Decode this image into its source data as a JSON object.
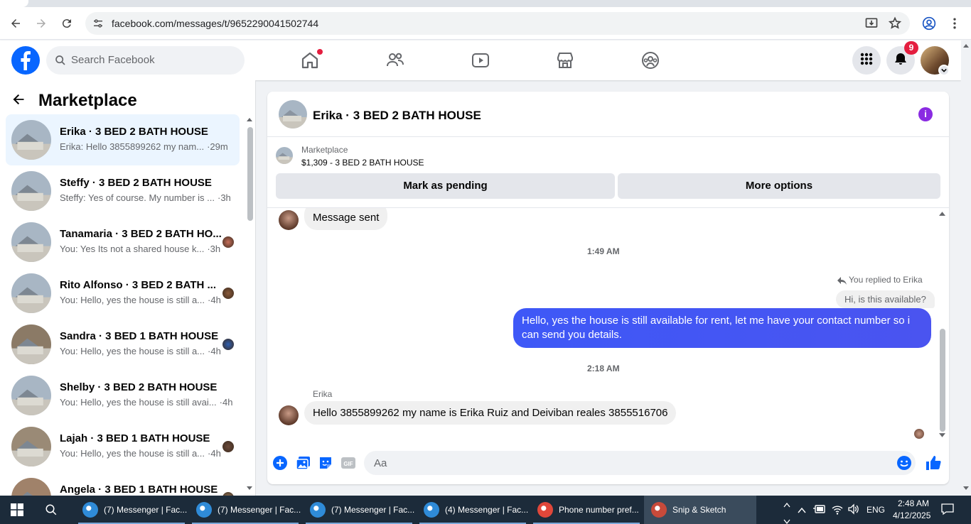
{
  "browser": {
    "url": "facebook.com/messages/t/9652290041502744"
  },
  "fb_header": {
    "search_placeholder": "Search Facebook",
    "notification_count": "9"
  },
  "sidebar": {
    "title": "Marketplace",
    "conversations": [
      {
        "title": "Erika · 3 BED 2 BATH HOUSE",
        "preview": "Erika: Hello 3855899262 my nam...",
        "time": "·29m",
        "active": true
      },
      {
        "title": "Steffy · 3 BED 2 BATH HOUSE",
        "preview": "Steffy: Yes of course. My number is ...",
        "time": "·3h",
        "active": false
      },
      {
        "title": "Tanamaria · 3 BED 2 BATH HO...",
        "preview": "You: Yes Its not a shared house k...",
        "time": "·3h",
        "active": false
      },
      {
        "title": "Rito Alfonso · 3 BED 2 BATH ...",
        "preview": "You: Hello, yes the house is still a...",
        "time": "·4h",
        "active": false
      },
      {
        "title": "Sandra · 3 BED 1 BATH HOUSE",
        "preview": "You: Hello, yes the house is still a...",
        "time": "·4h",
        "active": false
      },
      {
        "title": "Shelby · 3 BED 2 BATH HOUSE",
        "preview": "You: Hello, yes the house is still avai...",
        "time": "·4h",
        "active": false
      },
      {
        "title": "Lajah · 3 BED 1 BATH HOUSE",
        "preview": "You: Hello, yes the house is still a...",
        "time": "·4h",
        "active": false
      },
      {
        "title": "Angela · 3 BED 1 BATH HOUSE",
        "preview": "",
        "time": "",
        "active": false
      }
    ]
  },
  "chat": {
    "title": "Erika · 3 BED 2 BATH HOUSE",
    "listing": {
      "label": "Marketplace",
      "price_title": "$1,309 - 3 BED 2 BATH HOUSE",
      "mark_pending": "Mark as pending",
      "more_options": "More options"
    },
    "messages": {
      "msg_sent": "Message sent",
      "time_1": "1:49 AM",
      "replied_to": "You replied to Erika",
      "quoted": "Hi, is this available?",
      "reply": "Hello, yes the house is still available for rent, let me have your contact number so i can send you details.",
      "time_2": "2:18 AM",
      "sender_name": "Erika",
      "incoming": "Hello  3855899262 my name is Erika Ruiz and Deiviban reales 3855516706"
    },
    "composer_placeholder": "Aa"
  },
  "taskbar": {
    "items": [
      {
        "label": "(7) Messenger | Fac...",
        "active": false
      },
      {
        "label": "(7) Messenger | Fac...",
        "active": false
      },
      {
        "label": "(7) Messenger | Fac...",
        "active": false
      },
      {
        "label": "(4) Messenger | Fac...",
        "active": false
      },
      {
        "label": "Phone number pref...",
        "active": false
      },
      {
        "label": "Snip & Sketch",
        "active": true
      }
    ],
    "language": "ENG",
    "time": "2:48 AM",
    "date": "4/12/2025"
  },
  "colors": {
    "fb_blue": "#0866ff",
    "messenger_blue": "#3e58f7",
    "badge_red": "#e41e3f",
    "info_purple": "#8a2be2"
  }
}
